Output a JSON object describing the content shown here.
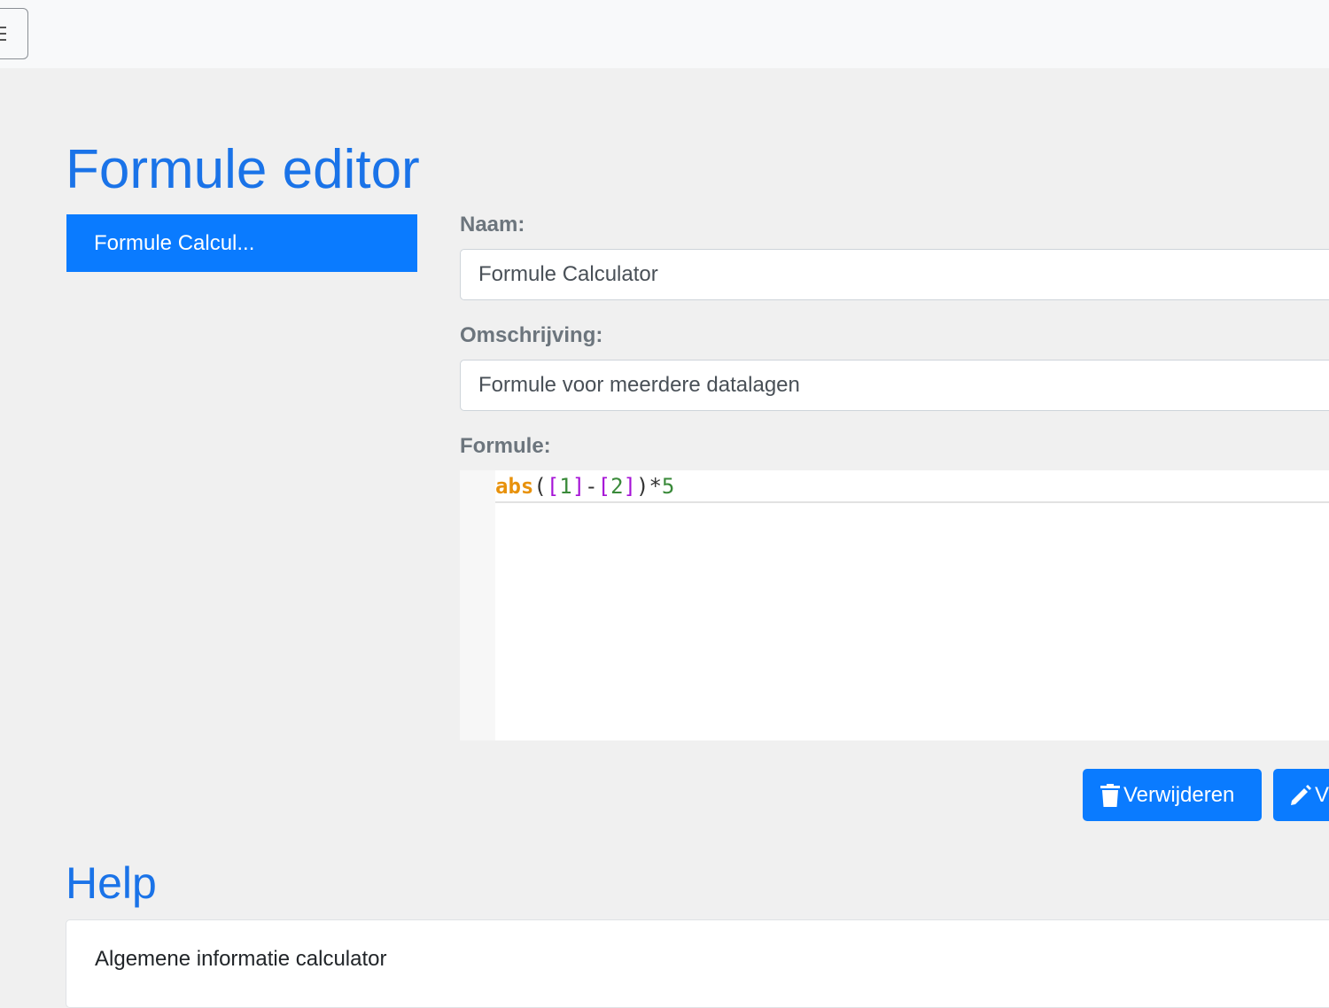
{
  "header": {
    "menu_icon": "hamburger-icon"
  },
  "page": {
    "title": "Formule editor"
  },
  "formula_list": {
    "items": [
      {
        "label": "Formule Calcul..."
      }
    ]
  },
  "form": {
    "name_label": "Naam:",
    "name_value": "Formule Calculator",
    "description_label": "Omschrijving:",
    "description_value": "Formule voor meerdere datalagen",
    "formula_label": "Formule:",
    "formula_code": "abs([1]-[2])*5",
    "formula_tokens": [
      {
        "text": "abs",
        "kind": "func"
      },
      {
        "text": "(",
        "kind": "op"
      },
      {
        "text": "[",
        "kind": "bracket"
      },
      {
        "text": "1",
        "kind": "num"
      },
      {
        "text": "]",
        "kind": "bracket"
      },
      {
        "text": "-",
        "kind": "op"
      },
      {
        "text": "[",
        "kind": "bracket"
      },
      {
        "text": "2",
        "kind": "num"
      },
      {
        "text": "]",
        "kind": "bracket"
      },
      {
        "text": ")",
        "kind": "op"
      },
      {
        "text": "*",
        "kind": "op"
      },
      {
        "text": "5",
        "kind": "num"
      }
    ]
  },
  "actions": {
    "delete_label": "Verwijderen",
    "delete_icon": "trash-icon",
    "edit_label": "V",
    "edit_icon": "pencil-icon"
  },
  "help": {
    "title": "Help",
    "card_header": "Algemene informatie calculator"
  },
  "colors": {
    "accent": "#0a7bff",
    "title": "#1a73e8",
    "background": "#f0f0f0",
    "token_func": "#e8920c",
    "token_bracket": "#a512d6",
    "token_num": "#3a8a3a"
  }
}
